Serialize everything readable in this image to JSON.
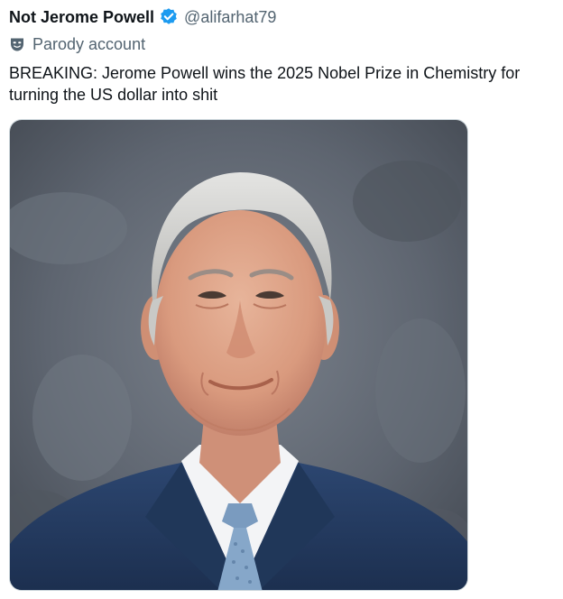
{
  "tweet": {
    "display_name": "Not Jerome Powell",
    "handle": "@alifarhat79",
    "verified_icon": "verified-badge-icon",
    "parody_icon": "theater-mask-icon",
    "parody_label": "Parody account",
    "text": "BREAKING: Jerome Powell wins the 2025 Nobel Prize in Chemistry for turning the US dollar into shit",
    "media": {
      "kind": "portrait-photo"
    }
  },
  "colors": {
    "text_primary": "#0f1419",
    "text_secondary": "#536471",
    "verified_blue": "#1d9bf0",
    "suit_navy": "#243a5e",
    "backdrop_gray": "#5e6570"
  }
}
